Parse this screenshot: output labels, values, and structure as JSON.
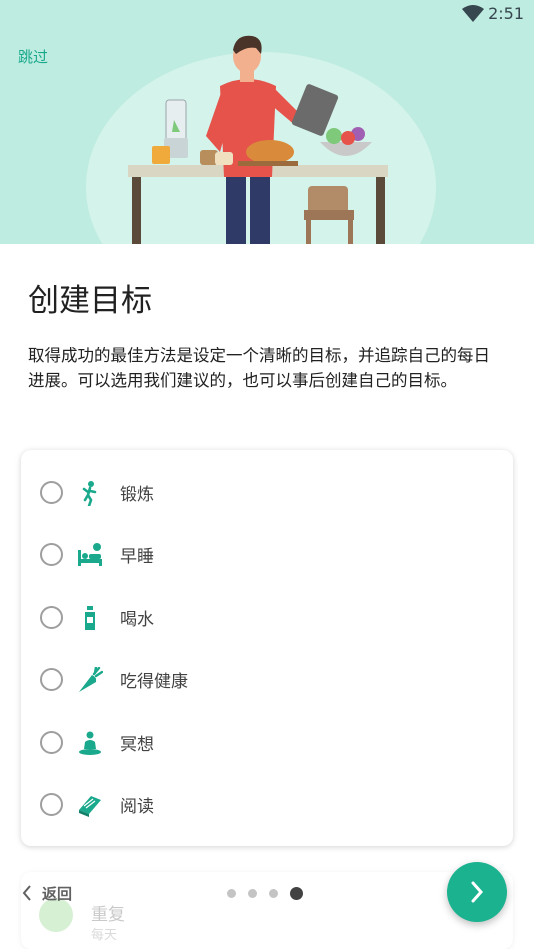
{
  "status_bar": {
    "time": "2:51",
    "wifi_icon": "wifi-icon"
  },
  "header": {
    "skip_label": "跳过",
    "illustration": "person-cooking-illustration"
  },
  "main": {
    "title": "创建目标",
    "description": "取得成功的最佳方法是设定一个清晰的目标，并追踪自己的每日进展。可以选用我们建议的，也可以事后创建自己的目标。"
  },
  "goals": [
    {
      "label": "锻炼",
      "icon": "exercise-icon",
      "selected": false
    },
    {
      "label": "早睡",
      "icon": "bed-icon",
      "selected": false
    },
    {
      "label": "喝水",
      "icon": "water-bottle-icon",
      "selected": false
    },
    {
      "label": "吃得健康",
      "icon": "carrot-icon",
      "selected": false
    },
    {
      "label": "冥想",
      "icon": "meditation-icon",
      "selected": false
    },
    {
      "label": "阅读",
      "icon": "book-icon",
      "selected": false
    }
  ],
  "background_card": {
    "title": "重复",
    "subtitle": "每天"
  },
  "navigation": {
    "back_label": "返回",
    "page_count": 4,
    "current_page": 4
  },
  "colors": {
    "accent": "#1bb28f",
    "header_bg": "#bfece0",
    "icon": "#1aa98c"
  }
}
